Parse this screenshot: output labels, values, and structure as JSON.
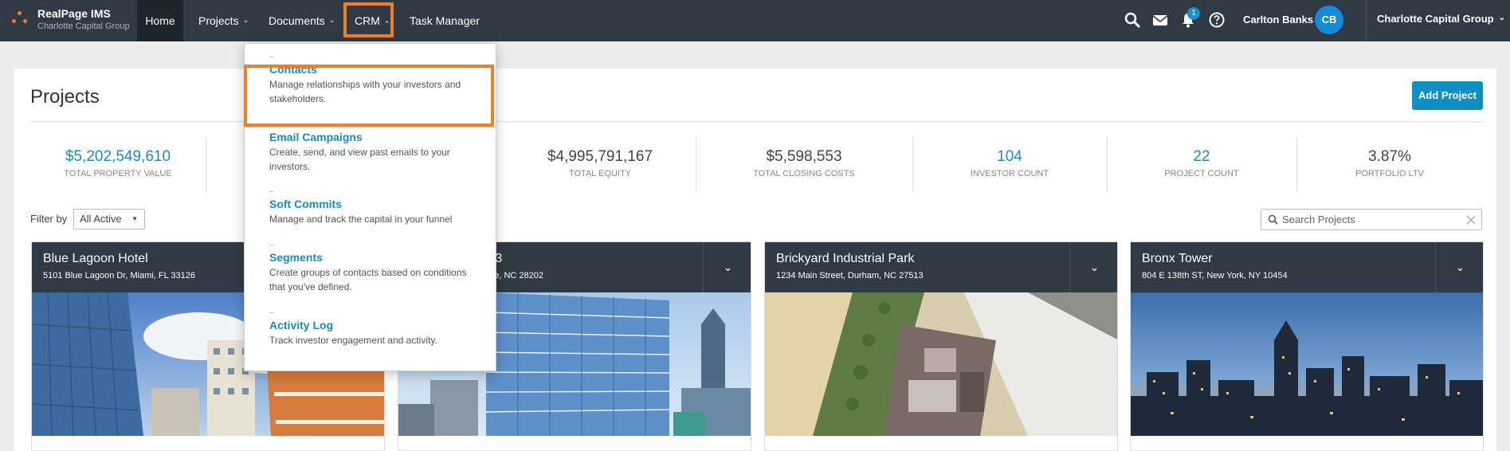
{
  "brand": {
    "name": "RealPage IMS",
    "sub": "Charlotte Capital Group"
  },
  "nav": {
    "home": "Home",
    "projects": "Projects",
    "documents": "Documents",
    "crm": "CRM",
    "task_manager": "Task Manager",
    "chevron_down": "⌄",
    "chevron_up": "⌃"
  },
  "icons": {
    "search": "search-icon",
    "mail": "mail-icon",
    "bell": "bell-icon",
    "help": "help-icon"
  },
  "notifications": {
    "count": "1"
  },
  "user": {
    "name": "Carlton Banks",
    "initials": "CB"
  },
  "org": {
    "name": "Charlotte Capital Group"
  },
  "page": {
    "title": "Projects",
    "add_button": "Add Project"
  },
  "stats": [
    {
      "value": "$5,202,549,610",
      "label": "TOTAL PROPERTY VALUE",
      "color": "#1b8bbd"
    },
    {
      "value": "$4,995,791,167",
      "label": "TOTAL EQUITY",
      "color": "#444444"
    },
    {
      "value": "$5,598,553",
      "label": "TOTAL CLOSING COSTS",
      "color": "#444444"
    },
    {
      "value": "104",
      "label": "INVESTOR COUNT",
      "color": "#1b8bbd"
    },
    {
      "value": "22",
      "label": "PROJECT COUNT",
      "color": "#1b8bbd"
    },
    {
      "value": "3.87%",
      "label": "PORTFOLIO LTV",
      "color": "#444444"
    }
  ],
  "filter": {
    "label": "Filter by",
    "value": "All Active"
  },
  "search": {
    "placeholder": "Search Projects"
  },
  "cards": [
    {
      "name": "Blue Lagoon Hotel",
      "address": "5101 Blue Lagoon Dr, Miami, FL 33126"
    },
    {
      "name": "g 3",
      "address": "otte, NC 28202"
    },
    {
      "name": "Brickyard Industrial Park",
      "address": "1234 Main Street, Durham, NC 27513"
    },
    {
      "name": "Bronx Tower",
      "address": "804 E 138th ST, New York, NY 10454"
    }
  ],
  "crm_menu": [
    {
      "title": "Contacts",
      "desc": "Manage relationships with your investors and stakeholders."
    },
    {
      "title": "Email Campaigns",
      "desc": "Create, send, and view past emails to your investors."
    },
    {
      "title": "Soft Commits",
      "desc": "Manage and track the capital in your funnel"
    },
    {
      "title": "Segments",
      "desc": "Create groups of contacts based on conditions that you've defined."
    },
    {
      "title": "Activity Log",
      "desc": "Track investor engagement and activity."
    }
  ],
  "colors": {
    "nav_bg": "#2f3a45",
    "accent": "#1b8bbd",
    "highlight": "#f07f26",
    "button": "#0e8fc3"
  }
}
